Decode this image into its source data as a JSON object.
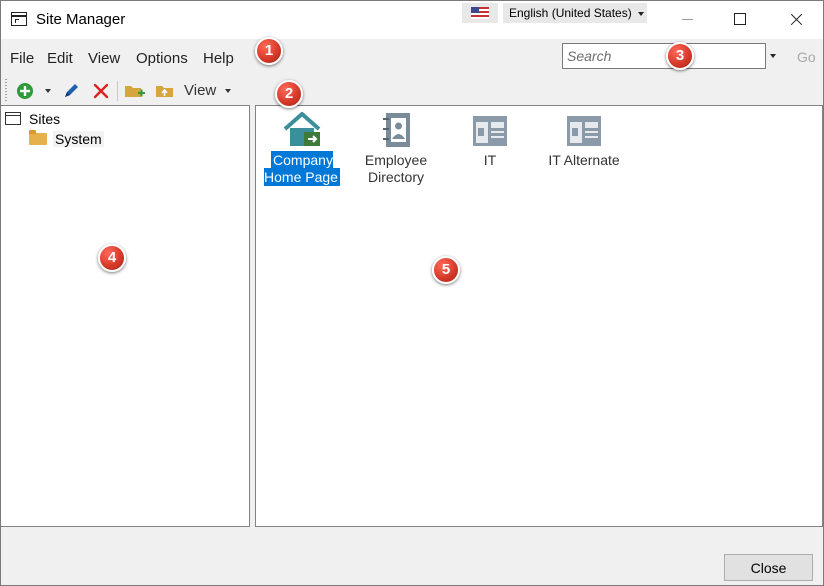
{
  "window": {
    "title": "Site Manager"
  },
  "language": {
    "selected": "English (United States)"
  },
  "menu": {
    "items": [
      "File",
      "Edit",
      "View",
      "Options",
      "Help"
    ]
  },
  "search": {
    "placeholder": "Search",
    "go_label": "Go"
  },
  "toolbar": {
    "view_label": "View"
  },
  "tree": {
    "root": "Sites",
    "child": "System"
  },
  "tiles": [
    {
      "label": "Company Home Page",
      "selected": true
    },
    {
      "label": "Employee Directory",
      "selected": false
    },
    {
      "label": "IT",
      "selected": false
    },
    {
      "label": "IT Alternate",
      "selected": false
    }
  ],
  "callouts": [
    "1",
    "2",
    "3",
    "4",
    "5"
  ],
  "footer": {
    "close_label": "Close"
  },
  "colors": {
    "selection": "#0078d7",
    "callout": "#d83a2a",
    "house_teal": "#3a8f9a",
    "house_green": "#3d7a3a"
  }
}
